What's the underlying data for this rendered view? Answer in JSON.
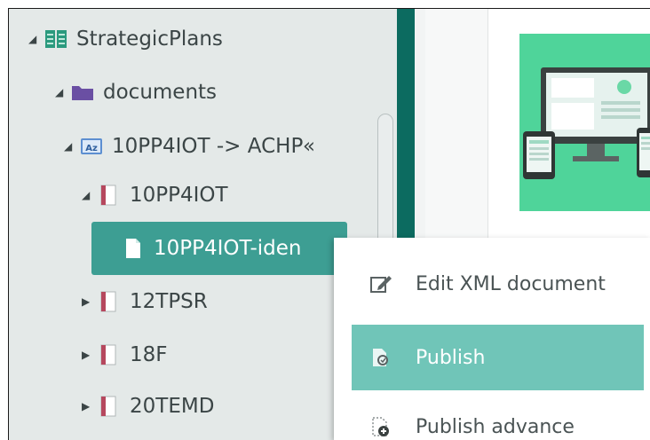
{
  "tree": {
    "items": [
      {
        "label": "StrategicPlans",
        "icon": "repository-icon",
        "expanded": true
      },
      {
        "label": "documents",
        "icon": "folder-icon",
        "expanded": true
      },
      {
        "label": "10PP4IOT -> ACHP«",
        "icon": "collection-az-icon",
        "expanded": true
      },
      {
        "label": "10PP4IOT",
        "icon": "book-icon",
        "expanded": true
      },
      {
        "label": "10PP4IOT-iden",
        "icon": "document-icon",
        "selected": true
      },
      {
        "label": "12TPSR",
        "icon": "book-icon",
        "expanded": false
      },
      {
        "label": "18F",
        "icon": "book-icon",
        "expanded": false
      },
      {
        "label": "20TEMD",
        "icon": "book-icon",
        "expanded": false
      }
    ]
  },
  "context_menu": {
    "items": [
      {
        "label": "Edit XML document",
        "icon": "edit-document-icon"
      },
      {
        "label": "Publish",
        "icon": "publish-icon",
        "active": true
      },
      {
        "label": "Publish advance",
        "icon": "publish-advance-icon"
      }
    ]
  },
  "colors": {
    "tree_background": "#e4e9e8",
    "selection": "#3d9e93",
    "menu_active": "#70c5b8",
    "teal_bar": "#0c6b60",
    "thumbnail": "#4fd49a",
    "folder": "#6a4fa3",
    "repository": "#2b9a7e"
  }
}
